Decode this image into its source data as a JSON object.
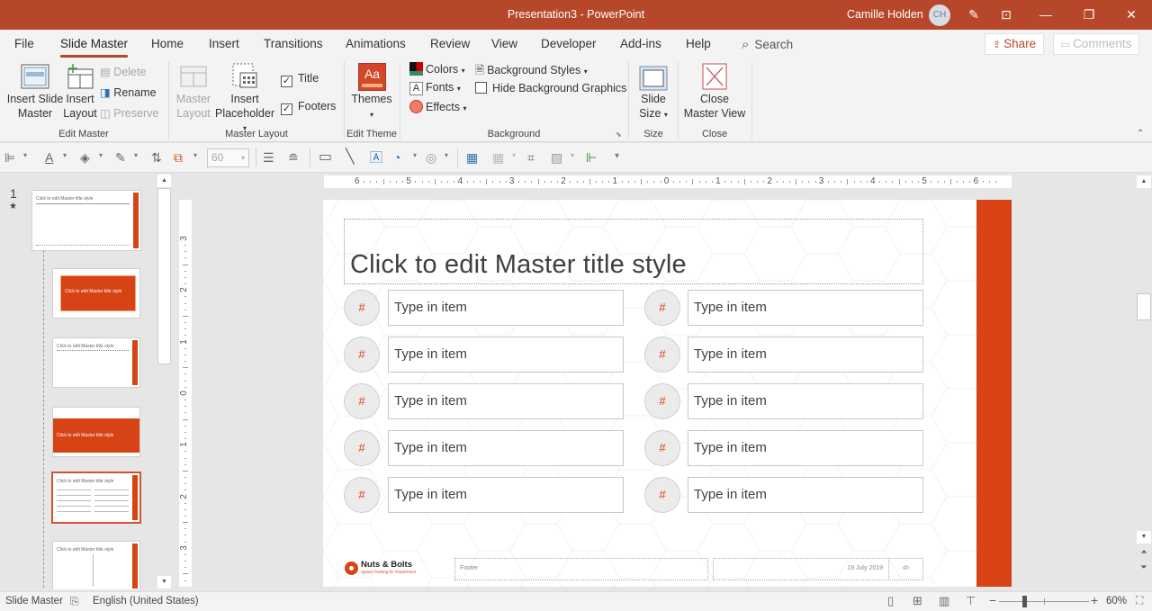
{
  "window": {
    "title": "Presentation3  -  PowerPoint",
    "user_name": "Camille Holden",
    "user_initials": "CH",
    "icons": [
      "pen-icon",
      "ribbon-display-icon",
      "minimize-icon",
      "restore-icon",
      "close-icon"
    ]
  },
  "tabs": [
    {
      "label": "File"
    },
    {
      "label": "Slide Master",
      "active": true
    },
    {
      "label": "Home"
    },
    {
      "label": "Insert"
    },
    {
      "label": "Transitions"
    },
    {
      "label": "Animations"
    },
    {
      "label": "Review"
    },
    {
      "label": "View"
    },
    {
      "label": "Developer"
    },
    {
      "label": "Add-ins"
    },
    {
      "label": "Help"
    }
  ],
  "search_label": "Search",
  "share_label": "Share",
  "comments_label": "Comments",
  "ribbon": {
    "edit_master": {
      "label": "Edit Master",
      "insert_slide_master": [
        "Insert Slide",
        "Master"
      ],
      "insert_layout": [
        "Insert",
        "Layout"
      ],
      "delete": "Delete",
      "rename": "Rename",
      "preserve": "Preserve"
    },
    "master_layout": {
      "label": "Master Layout",
      "master_layout_btn": [
        "Master",
        "Layout"
      ],
      "insert_placeholder": [
        "Insert",
        "Placeholder"
      ],
      "title_checkbox": {
        "label": "Title",
        "checked": true
      },
      "footers_checkbox": {
        "label": "Footers",
        "checked": true
      }
    },
    "edit_theme": {
      "label": "Edit Theme",
      "themes": "Themes"
    },
    "background": {
      "label": "Background",
      "colors": "Colors",
      "fonts": "Fonts",
      "effects": "Effects",
      "background_styles": "Background Styles",
      "hide_background_graphics": {
        "label": "Hide Background Graphics",
        "checked": false
      }
    },
    "size": {
      "label": "Size",
      "slide_size": [
        "Slide",
        "Size"
      ]
    },
    "close": {
      "label": "Close",
      "close_master_view": [
        "Close",
        "Master View"
      ]
    }
  },
  "quick_toolbar": {
    "font_size_value": "60"
  },
  "thumbnails": {
    "master_number": "1",
    "master_title": "Click to edit Master title style",
    "count_visible": 6,
    "selected_index": 4
  },
  "rulers": {
    "horizontal": [
      "6",
      "5",
      "4",
      "3",
      "2",
      "1",
      "0",
      "1",
      "2",
      "3",
      "4",
      "5",
      "6"
    ],
    "vertical": [
      "3",
      "2",
      "1",
      "0",
      "1",
      "2",
      "3"
    ]
  },
  "slide": {
    "title_placeholder": "Click to edit Master title style",
    "number_symbol": "#",
    "items_left": [
      "Type in item",
      "Type in item",
      "Type in item",
      "Type in item",
      "Type in item"
    ],
    "items_right": [
      "Type in item",
      "Type in item",
      "Type in item",
      "Type in item",
      "Type in item"
    ],
    "logo_name": "Nuts & Bolts",
    "logo_tagline": "Speed Training for PowerPoint",
    "footer_text": "Footer",
    "date_text": "19 July 2019",
    "slide_number_text": "‹#›",
    "accent_color": "#d84315"
  },
  "status": {
    "view_name": "Slide Master",
    "language": "English (United States)",
    "zoom_percent": "60%",
    "zoom_value": 60
  }
}
